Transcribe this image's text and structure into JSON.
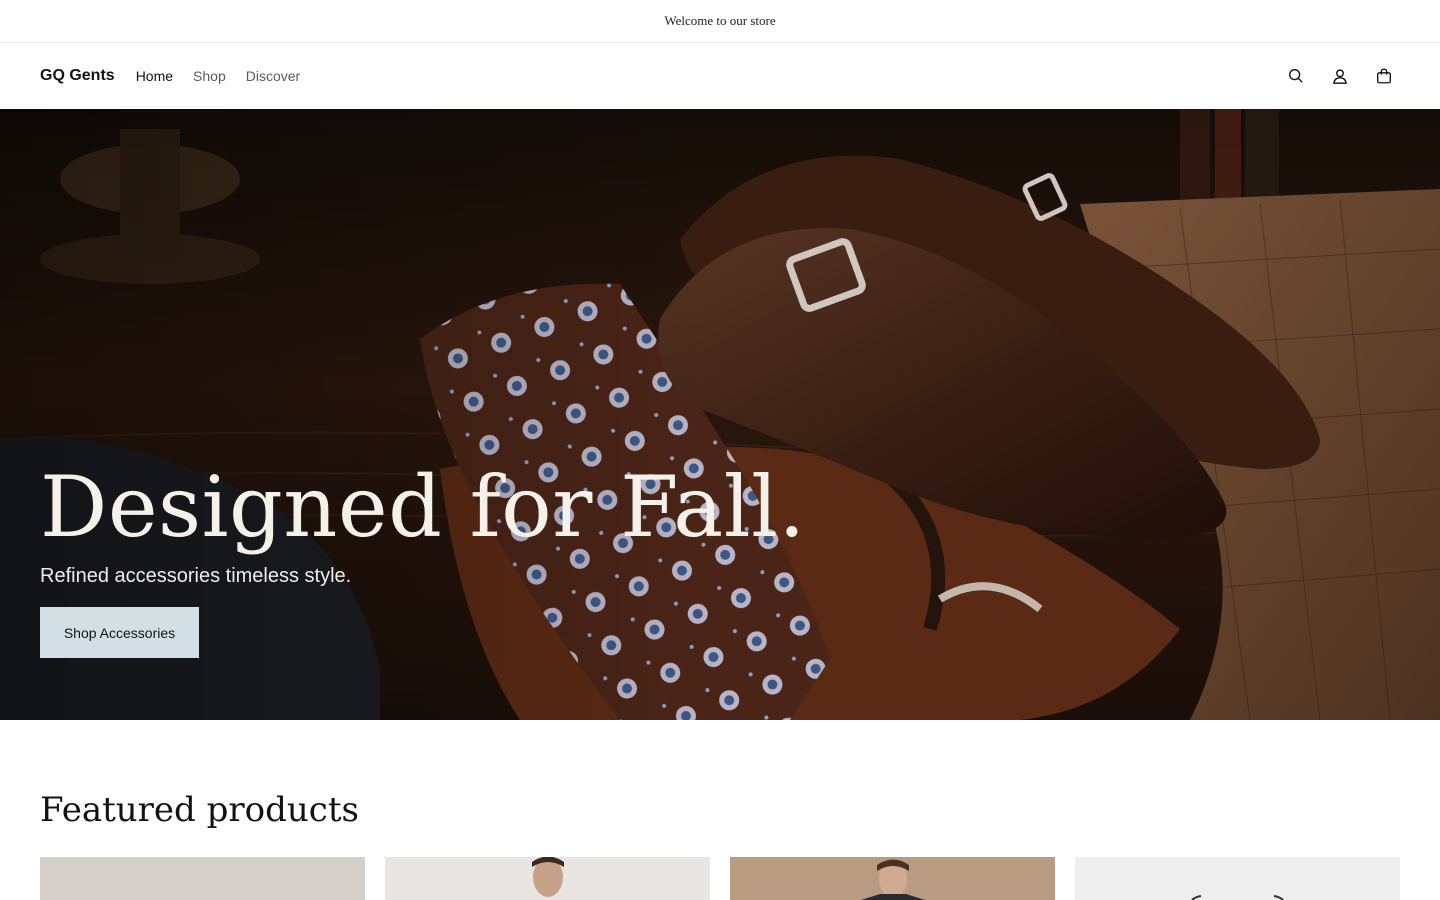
{
  "announcement": {
    "text": "Welcome to our store"
  },
  "header": {
    "logo": "GQ Gents",
    "nav": [
      {
        "label": "Home",
        "active": true
      },
      {
        "label": "Shop",
        "active": false
      },
      {
        "label": "Discover",
        "active": false
      }
    ],
    "icons": [
      "search-icon",
      "account-icon",
      "cart-icon"
    ]
  },
  "hero": {
    "title": "Designed for Fall.",
    "subtitle": "Refined accessories timeless style.",
    "cta_label": "Shop Accessories",
    "cta_color": "#d2e0e6"
  },
  "featured": {
    "title": "Featured products"
  },
  "colors": {
    "accent": "#d2e0e6",
    "text": "#121212",
    "nav_inactive": "#5b5b5b",
    "hero_bg": "#1e120b"
  }
}
